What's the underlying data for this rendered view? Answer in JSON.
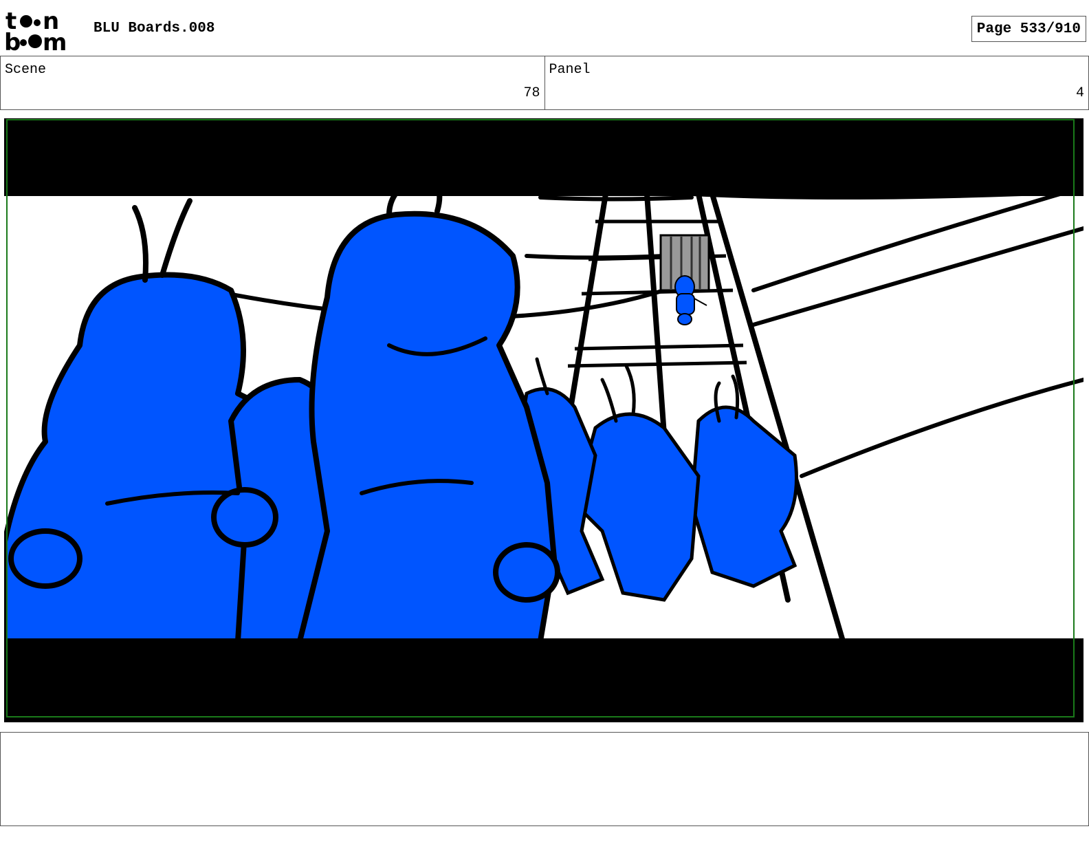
{
  "header": {
    "logo_text_line1": "toon",
    "logo_text_line2": "boom",
    "project_title": "BLU Boards.008",
    "page_indicator": "Page 533/910"
  },
  "info": {
    "scene_label": "Scene",
    "scene_value": "78",
    "panel_label": "Panel",
    "panel_value": "4"
  },
  "notes": {
    "text": ""
  },
  "colors": {
    "character_blue": "#0055FF",
    "frame_green": "#1a7a1a",
    "letterbox": "#000000"
  }
}
